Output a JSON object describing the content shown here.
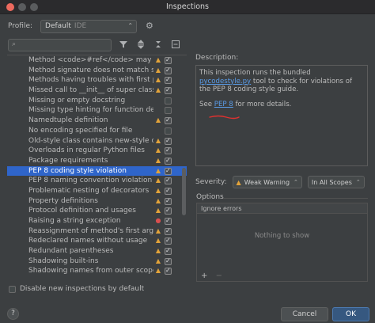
{
  "window": {
    "title": "Inspections"
  },
  "profile": {
    "label": "Profile:",
    "value": "Default",
    "scope_tag": "IDE"
  },
  "search": {
    "placeholder": ""
  },
  "inspections": [
    {
      "label": "Method <code>#ref</code> may be 's",
      "severity": "warning",
      "checked": true
    },
    {
      "label": "Method signature does not match signature",
      "severity": "warning",
      "checked": true
    },
    {
      "label": "Methods having troubles with first parameter",
      "severity": "warning",
      "checked": true
    },
    {
      "label": "Missed call to __init__ of super class",
      "severity": "warning",
      "checked": true
    },
    {
      "label": "Missing or empty docstring",
      "severity": "",
      "checked": false
    },
    {
      "label": "Missing type hinting for function definition",
      "severity": "",
      "checked": false
    },
    {
      "label": "Namedtuple definition",
      "severity": "warning",
      "checked": true
    },
    {
      "label": "No encoding specified for file",
      "severity": "",
      "checked": false
    },
    {
      "label": "Old-style class contains new-style class features",
      "severity": "warning",
      "checked": true
    },
    {
      "label": "Overloads in regular Python files",
      "severity": "warning",
      "checked": true
    },
    {
      "label": "Package requirements",
      "severity": "warning",
      "checked": true
    },
    {
      "label": "PEP 8 coding style violation",
      "severity": "warning",
      "checked": true,
      "selected": true
    },
    {
      "label": "PEP 8 naming convention violation",
      "severity": "warning",
      "checked": true
    },
    {
      "label": "Problematic nesting of decorators",
      "severity": "warning",
      "checked": true
    },
    {
      "label": "Property definitions",
      "severity": "warning",
      "checked": true
    },
    {
      "label": "Protocol definition and usages",
      "severity": "warning",
      "checked": true
    },
    {
      "label": "Raising a string exception",
      "severity": "error",
      "checked": true
    },
    {
      "label": "Reassignment of method's first argument",
      "severity": "warning",
      "checked": true
    },
    {
      "label": "Redeclared names without usage",
      "severity": "warning",
      "checked": true
    },
    {
      "label": "Redundant parentheses",
      "severity": "warning",
      "checked": true
    },
    {
      "label": "Shadowing built-ins",
      "severity": "warning",
      "checked": true
    },
    {
      "label": "Shadowing names from outer scopes",
      "severity": "warning",
      "checked": true
    }
  ],
  "description": {
    "label": "Description:",
    "line1_pre": "This inspection runs the bundled ",
    "line1_link": "pycodestyle.py",
    "line1_post": " tool to check for violations of the PEP 8 coding style guide.",
    "see_pre": "See ",
    "see_link": "PEP 8",
    "see_post": " for more details."
  },
  "severity": {
    "label": "Severity:",
    "value": "Weak Warning",
    "scope": "In All Scopes"
  },
  "options": {
    "label": "Options",
    "column_header": "Ignore errors",
    "empty_text": "Nothing to show",
    "add": "+",
    "remove": "−"
  },
  "footer": {
    "disable_label": "Disable new inspections by default",
    "help": "?",
    "cancel": "Cancel",
    "ok": "OK"
  },
  "colors": {
    "accent": "#2f65ca",
    "link": "#5a9be6",
    "warning": "#e2a33a",
    "error": "#d94f4f",
    "annotation": "#e0312f"
  }
}
